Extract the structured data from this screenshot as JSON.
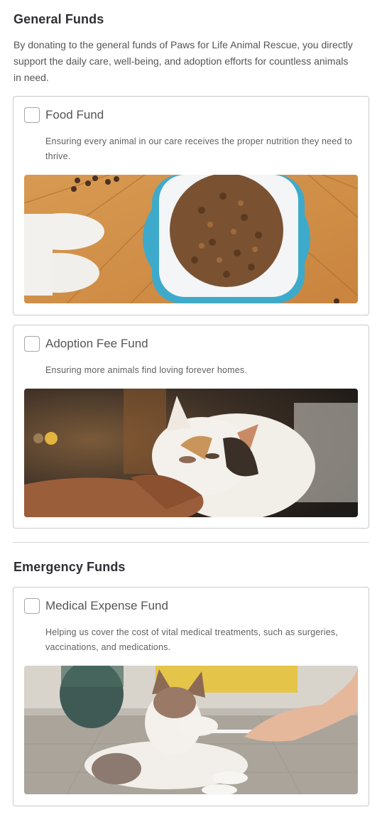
{
  "general": {
    "title": "General Funds",
    "description": "By donating to the general funds of Paws for Life Animal Rescue, you directly support the daily care, well-being, and adoption efforts for countless animals in need."
  },
  "emergency": {
    "title": "Emergency Funds"
  },
  "funds": [
    {
      "title": "Food Fund",
      "description": "Ensuring every animal in our care receives the proper nutrition they need to thrive.",
      "checked": false,
      "image": "dog-paws-food-bowl-photo"
    },
    {
      "title": "Adoption Fee Fund",
      "description": "Ensuring more animals find loving forever homes.",
      "checked": false,
      "image": "cat-being-petted-photo"
    },
    {
      "title": "Medical Expense Fund",
      "description": "Helping us cover the cost of vital medical treatments, such as surgeries, vaccinations, and medications.",
      "checked": false,
      "image": "puppy-receiving-medicine-photo"
    }
  ]
}
